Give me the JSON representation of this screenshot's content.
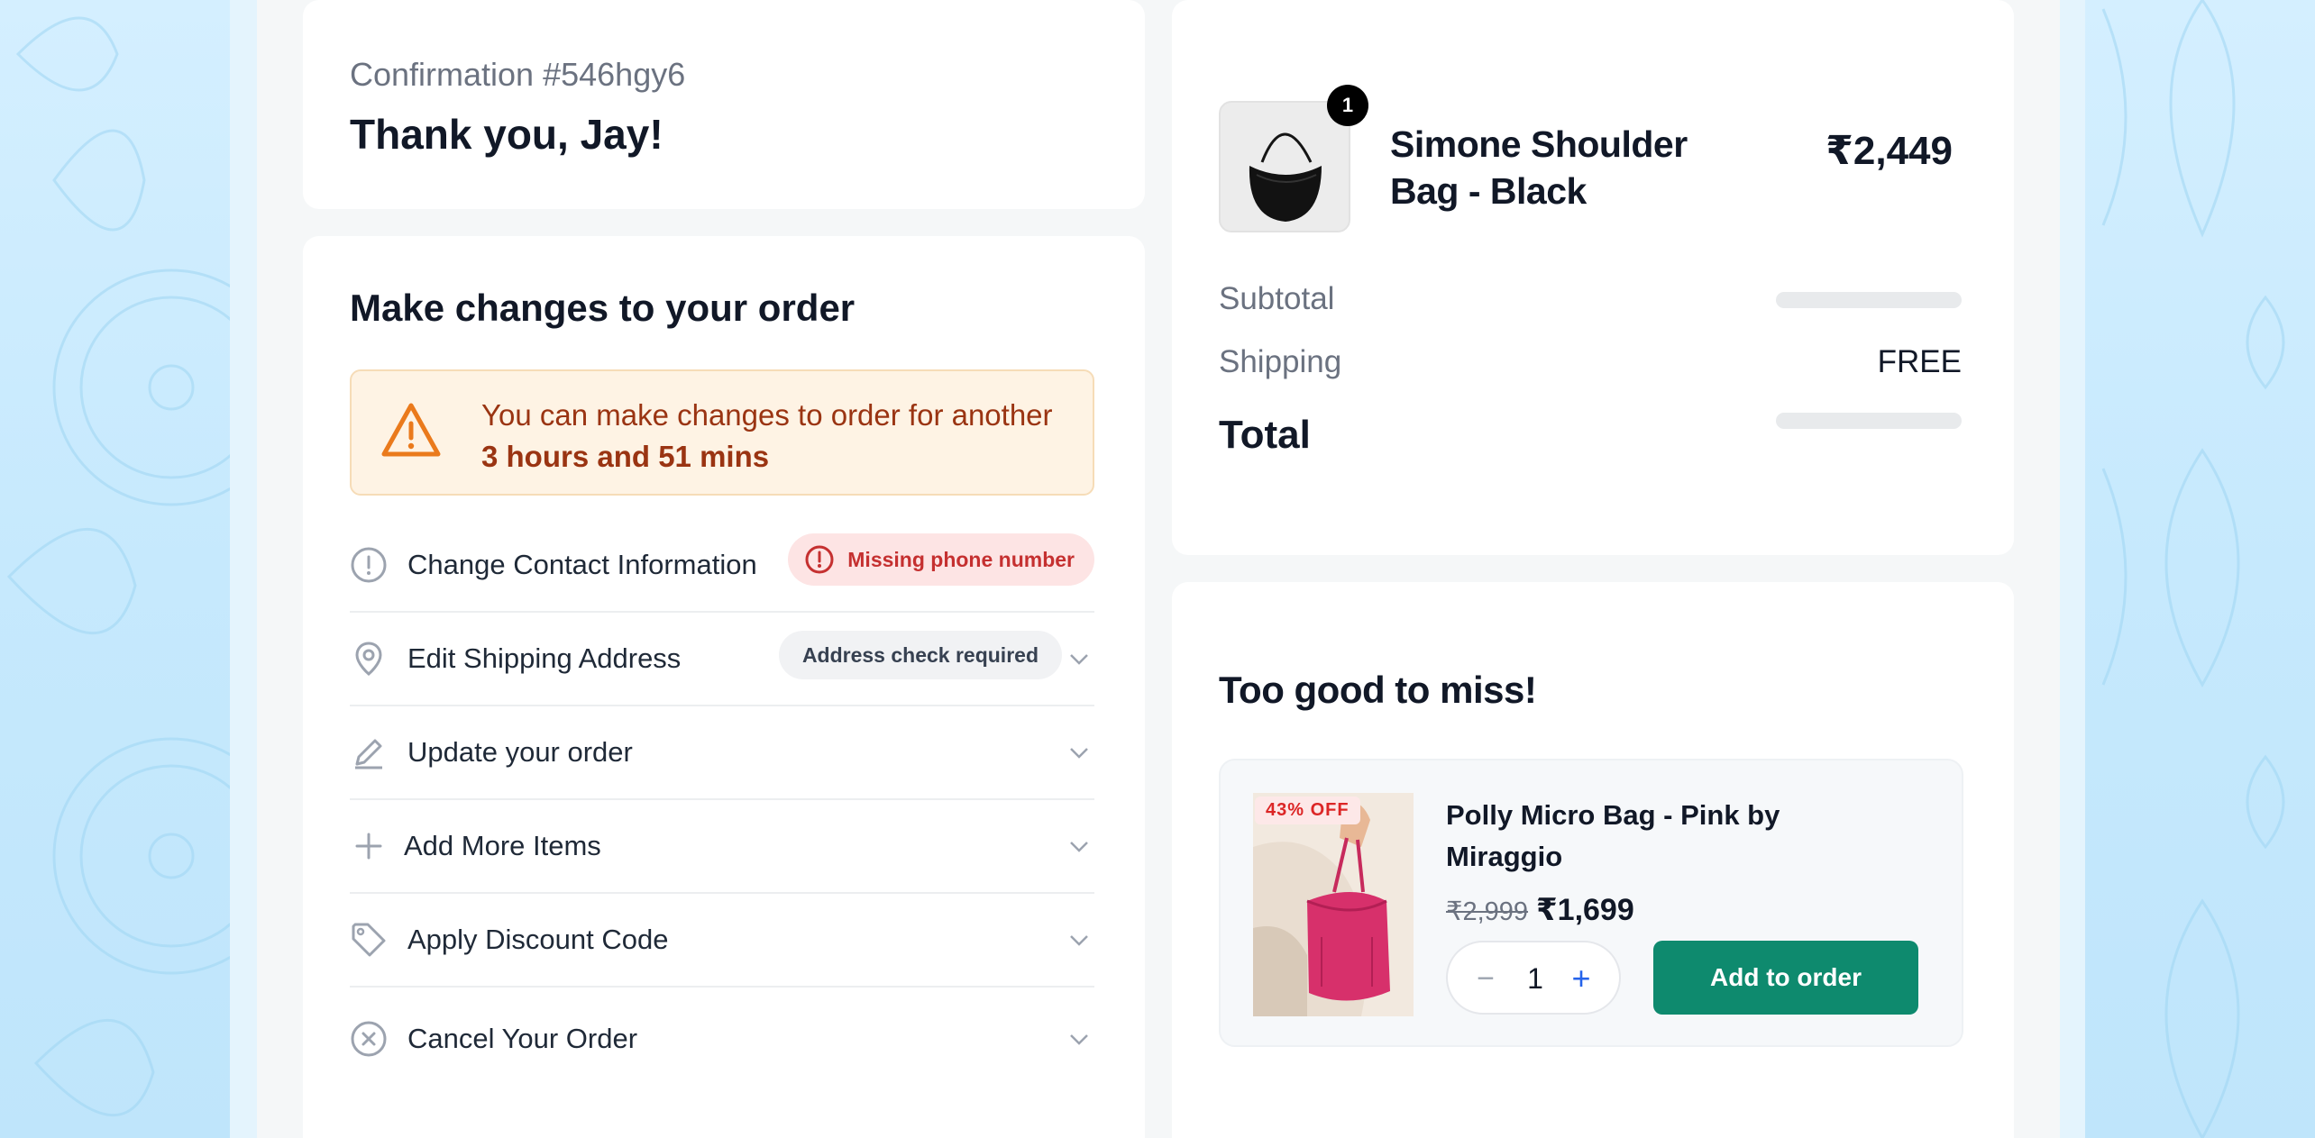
{
  "confirmation": {
    "label": "Confirmation #546hgy6",
    "thanks": "Thank you, Jay!"
  },
  "changes": {
    "title": "Make changes to your order",
    "alert_prefix": "You can make changes to order for another ",
    "alert_time": "3 hours and 51 mins",
    "rows": [
      {
        "label": "Change Contact Information",
        "icon": "alert-circle-icon",
        "badge": "Missing phone number"
      },
      {
        "label": "Edit Shipping Address",
        "icon": "map-pin-icon",
        "badge": "Address check required"
      },
      {
        "label": "Update your order",
        "icon": "pencil-icon"
      },
      {
        "label": "Add More Items",
        "icon": "plus-icon"
      },
      {
        "label": "Apply Discount Code",
        "icon": "tag-icon"
      },
      {
        "label": "Cancel Your Order",
        "icon": "x-circle-icon"
      }
    ]
  },
  "summary": {
    "product_name": "Simone Shoulder Bag - Black",
    "product_qty": "1",
    "product_price": "₹2,449",
    "subtotal_label": "Subtotal",
    "shipping_label": "Shipping",
    "shipping_value": "FREE",
    "total_label": "Total"
  },
  "upsell": {
    "title": "Too good to miss!",
    "discount_tag": "43% OFF",
    "name": "Polly Micro Bag - Pink by Miraggio",
    "old_price": "₹2,999",
    "new_price": "₹1,699",
    "quantity": "1",
    "minus": "−",
    "plus": "+",
    "add_button": "Add to order"
  },
  "colors": {
    "accent_green": "#0e8a6e",
    "alert_bg": "#fef3e4",
    "alert_text": "#9a3412",
    "error_red": "#c53030",
    "stepper_plus": "#2563eb"
  }
}
